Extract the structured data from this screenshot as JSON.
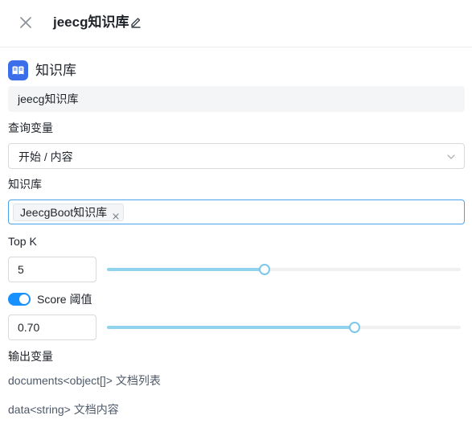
{
  "header": {
    "title": "jeecg知识库",
    "close_icon": "close-icon",
    "edit_icon": "edit-pencil-icon"
  },
  "node": {
    "icon": "book-icon",
    "icon_color": "#3b6ee8",
    "title": "知识库",
    "name_value": "jeecg知识库"
  },
  "query_variable": {
    "label": "查询变量",
    "value": "开始 / 内容"
  },
  "knowledge_base": {
    "label": "知识库",
    "tags": [
      "JeecgBoot知识库"
    ]
  },
  "top_k": {
    "label": "Top K",
    "value": "5",
    "slider_fraction": 0.445
  },
  "score": {
    "enabled": true,
    "label": "Score 阈值",
    "value": "0.70",
    "slider_fraction": 0.7
  },
  "output": {
    "label": "输出变量",
    "items": [
      "documents<object[]> 文档列表",
      "data<string> 文档内容"
    ]
  },
  "colors": {
    "accent": "#1890ff",
    "slider_track": "#8fd3ee",
    "focus_border": "#4aa3e8"
  }
}
